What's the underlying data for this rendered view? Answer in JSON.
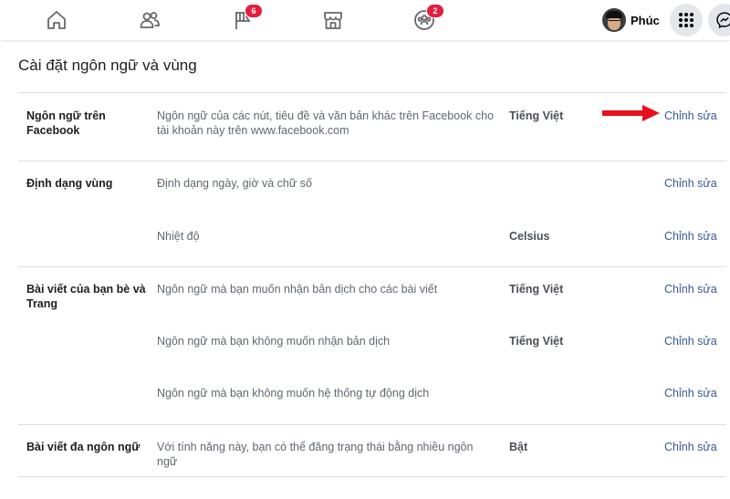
{
  "topbar": {
    "nav": [
      {
        "name": "home-icon"
      },
      {
        "name": "friends-icon"
      },
      {
        "name": "pages-flag-icon",
        "badge": "6"
      },
      {
        "name": "marketplace-icon"
      },
      {
        "name": "groups-icon",
        "badge": "2"
      }
    ],
    "profile_name": "Phúc",
    "menu_icon": "grid-menu-icon",
    "messenger_icon": "messenger-icon"
  },
  "page": {
    "title": "Cài đặt ngôn ngữ và vùng"
  },
  "edit_label": "Chỉnh sửa",
  "sections": [
    {
      "label": "Ngôn ngữ trên Facebook",
      "rows": [
        {
          "desc": "Ngôn ngữ của các nút, tiêu đề và văn bản khác trên Facebook cho tài khoản này trên www.facebook.com",
          "value": "Tiếng Việt"
        }
      ]
    },
    {
      "label": "Định dạng vùng",
      "rows": [
        {
          "desc": "Định dạng ngày, giờ và chữ số",
          "value": ""
        },
        {
          "desc": "Nhiệt độ",
          "value": "Celsius"
        }
      ]
    },
    {
      "label": "Bài viết của bạn bè và Trang",
      "rows": [
        {
          "desc": "Ngôn ngữ mà bạn muốn nhận bản dịch cho các bài viết",
          "value": "Tiếng Việt"
        },
        {
          "desc": "Ngôn ngữ mà bạn không muốn nhận bản dịch",
          "value": "Tiếng Việt"
        },
        {
          "desc": "Ngôn ngữ mà bạn không muốn hệ thống tự động dịch",
          "value": ""
        }
      ]
    },
    {
      "label": "Bài viết đa ngôn ngữ",
      "rows": [
        {
          "desc": "Với tính năng này, bạn có thể đăng trạng thái bằng nhiều ngôn ngữ",
          "value": "Bật"
        }
      ]
    }
  ],
  "colors": {
    "link": "#385898",
    "badge": "#e41e3f",
    "arrow": "#e8101c"
  }
}
